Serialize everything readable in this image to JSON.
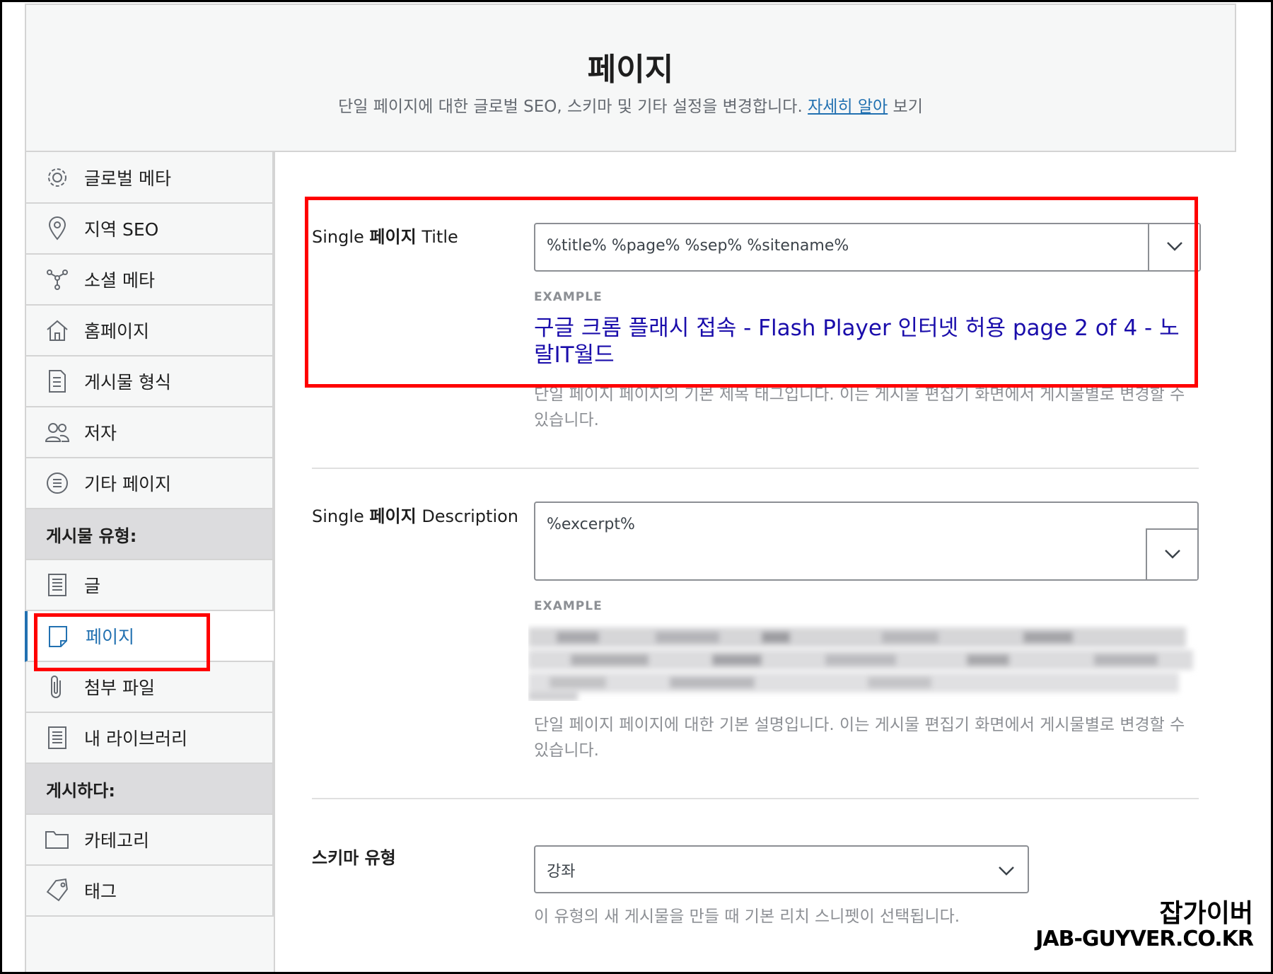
{
  "header": {
    "title": "페이지",
    "subtitle": "단일 페이지에 대한 글로벌 SEO, 스키마 및 기타 설정을 변경합니다.",
    "subtitle_link": "자세히 알아",
    "subtitle_suffix": "보기"
  },
  "sidebar": {
    "items": [
      {
        "label": "글로벌 메타",
        "icon": "gear-icon"
      },
      {
        "label": "지역 SEO",
        "icon": "location-pin-icon"
      },
      {
        "label": "소셜 메타",
        "icon": "share-icon"
      },
      {
        "label": "홈페이지",
        "icon": "home-icon"
      },
      {
        "label": "게시물 형식",
        "icon": "document-icon"
      },
      {
        "label": "저자",
        "icon": "users-icon"
      },
      {
        "label": "기타 페이지",
        "icon": "list-circle-icon"
      }
    ],
    "section_post_types": "게시물 유형:",
    "post_types": [
      {
        "label": "글",
        "icon": "post-icon"
      },
      {
        "label": "페이지",
        "icon": "page-icon",
        "active": true
      },
      {
        "label": "첨부 파일",
        "icon": "paperclip-icon"
      },
      {
        "label": "내 라이브러리",
        "icon": "library-icon"
      }
    ],
    "section_taxonomies": "게시하다:",
    "taxonomies": [
      {
        "label": "카테고리",
        "icon": "folder-icon"
      },
      {
        "label": "태그",
        "icon": "tag-icon"
      }
    ]
  },
  "title_field": {
    "label_prefix": "Single",
    "label_bold": "페이지",
    "label_suffix": "Title",
    "value": "%title% %page% %sep% %sitename%",
    "example_label": "EXAMPLE",
    "example_text": "구글 크롬 플래시 접속 - Flash Player 인터넷 허용 page 2 of 4 - 노랄IT월드",
    "help": "단일 페이지 페이지의 기본 제목 태그입니다. 이는 게시물 편집기 화면에서 게시물별로 변경할 수 있습니다."
  },
  "description_field": {
    "label_prefix": "Single",
    "label_bold": "페이지",
    "label_suffix": "Description",
    "value": "%excerpt%",
    "example_label": "EXAMPLE",
    "help": "단일 페이지 페이지에 대한 기본 설명입니다. 이는 게시물 편집기 화면에서 게시물별로 변경할 수 있습니다."
  },
  "schema_field": {
    "label": "스키마 유형",
    "value": "강좌",
    "help": "이 유형의 새 게시물을 만들 때 기본 리치 스니펫이 선택됩니다."
  },
  "watermark": {
    "line1": "잡가이버",
    "line2": "JAB-GUYVER.CO.KR"
  },
  "colors": {
    "accent": "#2271b1",
    "highlight": "#ff0000",
    "example_link": "#1a0dab"
  }
}
